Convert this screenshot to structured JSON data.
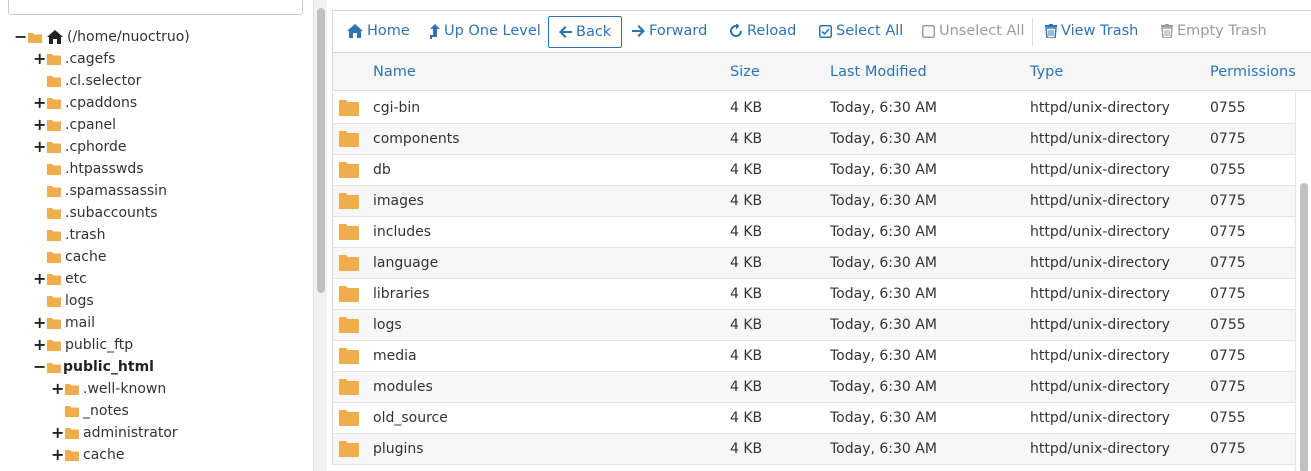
{
  "tree": {
    "root_label": "(/home/nuoctruo)",
    "nodes": [
      {
        "label": ".cagefs",
        "toggle": "+",
        "level": 1
      },
      {
        "label": ".cl.selector",
        "toggle": "",
        "level": 1
      },
      {
        "label": ".cpaddons",
        "toggle": "+",
        "level": 1
      },
      {
        "label": ".cpanel",
        "toggle": "+",
        "level": 1
      },
      {
        "label": ".cphorde",
        "toggle": "+",
        "level": 1
      },
      {
        "label": ".htpasswds",
        "toggle": "",
        "level": 1
      },
      {
        "label": ".spamassassin",
        "toggle": "",
        "level": 1
      },
      {
        "label": ".subaccounts",
        "toggle": "",
        "level": 1
      },
      {
        "label": ".trash",
        "toggle": "",
        "level": 1
      },
      {
        "label": "cache",
        "toggle": "",
        "level": 1
      },
      {
        "label": "etc",
        "toggle": "+",
        "level": 1
      },
      {
        "label": "logs",
        "toggle": "",
        "level": 1
      },
      {
        "label": "mail",
        "toggle": "+",
        "level": 1
      },
      {
        "label": "public_ftp",
        "toggle": "+",
        "level": 1
      },
      {
        "label": "public_html",
        "toggle": "−",
        "level": 1,
        "bold": true,
        "open": true
      },
      {
        "label": ".well-known",
        "toggle": "+",
        "level": 2
      },
      {
        "label": "_notes",
        "toggle": "",
        "level": 2
      },
      {
        "label": "administrator",
        "toggle": "+",
        "level": 2
      },
      {
        "label": "cache",
        "toggle": "+",
        "level": 2
      }
    ]
  },
  "toolbar": {
    "home": "Home",
    "up": "Up One Level",
    "back": "Back",
    "forward": "Forward",
    "reload": "Reload",
    "select_all": "Select All",
    "unselect_all": "Unselect All",
    "view_trash": "View Trash",
    "empty_trash": "Empty Trash"
  },
  "table": {
    "headers": {
      "name": "Name",
      "size": "Size",
      "modified": "Last Modified",
      "type": "Type",
      "perms": "Permissions"
    },
    "rows": [
      {
        "name": "cgi-bin",
        "size": "4 KB",
        "modified": "Today, 6:30 AM",
        "type": "httpd/unix-directory",
        "perms": "0755"
      },
      {
        "name": "components",
        "size": "4 KB",
        "modified": "Today, 6:30 AM",
        "type": "httpd/unix-directory",
        "perms": "0775"
      },
      {
        "name": "db",
        "size": "4 KB",
        "modified": "Today, 6:30 AM",
        "type": "httpd/unix-directory",
        "perms": "0755"
      },
      {
        "name": "images",
        "size": "4 KB",
        "modified": "Today, 6:30 AM",
        "type": "httpd/unix-directory",
        "perms": "0775"
      },
      {
        "name": "includes",
        "size": "4 KB",
        "modified": "Today, 6:30 AM",
        "type": "httpd/unix-directory",
        "perms": "0775"
      },
      {
        "name": "language",
        "size": "4 KB",
        "modified": "Today, 6:30 AM",
        "type": "httpd/unix-directory",
        "perms": "0775"
      },
      {
        "name": "libraries",
        "size": "4 KB",
        "modified": "Today, 6:30 AM",
        "type": "httpd/unix-directory",
        "perms": "0775"
      },
      {
        "name": "logs",
        "size": "4 KB",
        "modified": "Today, 6:30 AM",
        "type": "httpd/unix-directory",
        "perms": "0755"
      },
      {
        "name": "media",
        "size": "4 KB",
        "modified": "Today, 6:30 AM",
        "type": "httpd/unix-directory",
        "perms": "0775"
      },
      {
        "name": "modules",
        "size": "4 KB",
        "modified": "Today, 6:30 AM",
        "type": "httpd/unix-directory",
        "perms": "0775"
      },
      {
        "name": "old_source",
        "size": "4 KB",
        "modified": "Today, 6:30 AM",
        "type": "httpd/unix-directory",
        "perms": "0755"
      },
      {
        "name": "plugins",
        "size": "4 KB",
        "modified": "Today, 6:30 AM",
        "type": "httpd/unix-directory",
        "perms": "0775"
      }
    ]
  },
  "colors": {
    "link": "#2d74b5",
    "folder": "#f0ad4e",
    "disabled": "#9c9c9c"
  },
  "icons": {
    "home": "home-icon",
    "up": "level-up-icon",
    "back": "arrow-left-icon",
    "forward": "arrow-right-icon",
    "reload": "reload-icon",
    "select_all": "checked-box-icon",
    "unselect_all": "empty-box-icon",
    "view_trash": "trash-icon",
    "empty_trash": "trash-icon",
    "folder": "folder-icon",
    "folder_open": "folder-open-icon"
  }
}
